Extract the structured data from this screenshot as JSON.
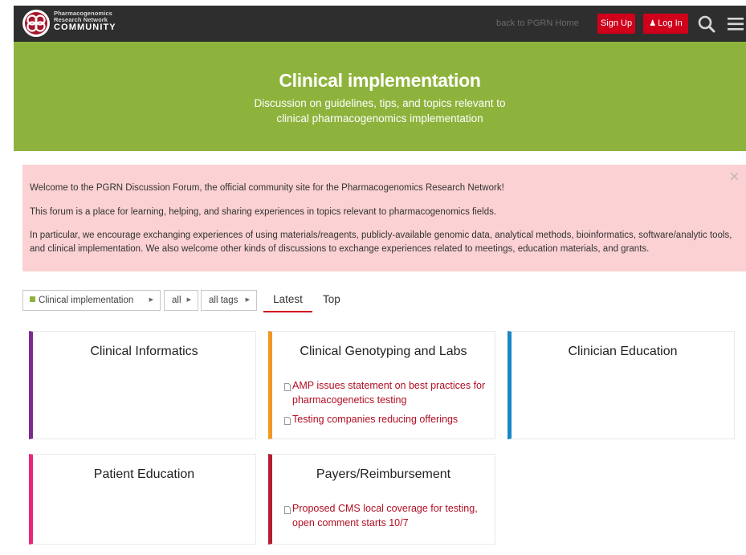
{
  "header": {
    "logo_line1": "Pharmacogenomics",
    "logo_line2": "Research Network",
    "logo_line3": "COMMUNITY",
    "back_link": "back to PGRN Home",
    "signup_label": "Sign Up",
    "login_label": "Log In",
    "icons": [
      "logo-icon",
      "user-icon",
      "search-icon",
      "menu-icon"
    ]
  },
  "banner": {
    "title": "Clinical implementation",
    "description": "Discussion on guidelines, tips, and topics relevant to clinical pharmacogenomics implementation"
  },
  "welcome": {
    "p1": "Welcome to the PGRN Discussion Forum, the official community site for the Pharmacogenomics Research Network!",
    "p2": "This forum is a place for learning, helping, and sharing experiences in topics relevant to pharmacogenomics fields.",
    "p3": "In particular, we encourage exchanging experiences of using materials/reagents, publicly-available genomic data, analytical methods, bioinformatics, software/analytic tools, and clinical implementation. We also welcome other kinds of discussions to exchange experiences related to meetings, education materials, and grants.",
    "close": "×"
  },
  "filters": {
    "category": "Clinical implementation",
    "subcategory": "all",
    "tags": "all tags",
    "tabs": [
      "Latest",
      "Top"
    ],
    "active_tab": "Latest"
  },
  "categories": [
    {
      "name": "Clinical Informatics",
      "color": "#7c2a8f",
      "topics": []
    },
    {
      "name": "Clinical Genotyping and Labs",
      "color": "#f29624",
      "topics": [
        "AMP issues statement on best practices for pharmacogenetics testing",
        "Testing companies reducing offerings"
      ]
    },
    {
      "name": "Clinician Education",
      "color": "#1a86c6",
      "topics": []
    },
    {
      "name": "Patient Education",
      "color": "#e8267c",
      "topics": []
    },
    {
      "name": "Payers/Reimbursement",
      "color": "#b31e33",
      "topics": [
        "Proposed CMS local coverage for testing, open comment starts 10/7"
      ]
    }
  ],
  "colors": {
    "header_bg": "#2e2e2e",
    "banner_bg": "#8eb33c",
    "accent_red": "#d0001b",
    "welcome_bg": "#fbd1d3",
    "topic_link": "#b00e22"
  }
}
